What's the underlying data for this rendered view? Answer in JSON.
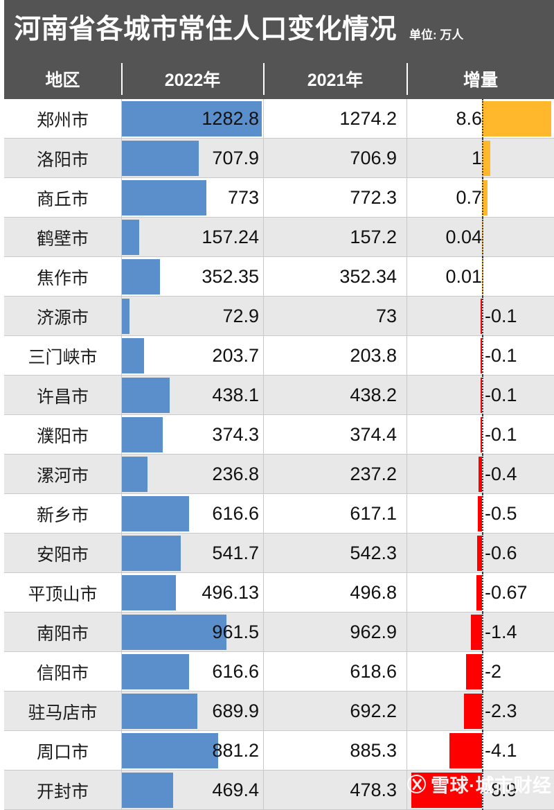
{
  "header": {
    "title": "河南省各城市常住人口变化情况",
    "unit_label": "单位: 万人",
    "columns": [
      "地区",
      "2022年",
      "2021年",
      "增量"
    ]
  },
  "watermark": {
    "text": "雪球·城市财经",
    "logo_icon": "xueqiu-x-logo-icon"
  },
  "colors": {
    "header_bg": "#545454",
    "bar_positive": "#5b8fcb",
    "delta_positive": "#ffb72b",
    "delta_negative": "#fe0000",
    "row_even_bg": "#e8e8e8",
    "row_odd_bg": "#ffffff",
    "grid_line": "#c9c9c9"
  },
  "chart_data": {
    "type": "bar",
    "title": "河南省各城市常住人口变化情况",
    "subtitle": "单位: 万人",
    "xlabel": "",
    "ylabel": "",
    "categories": [
      "郑州市",
      "洛阳市",
      "商丘市",
      "鹤壁市",
      "焦作市",
      "济源市",
      "三门峡市",
      "许昌市",
      "濮阳市",
      "漯河市",
      "新乡市",
      "安阳市",
      "平顶山市",
      "南阳市",
      "信阳市",
      "驻马店市",
      "周口市",
      "开封市"
    ],
    "series": [
      {
        "name": "2022年",
        "values": [
          1282.8,
          707.9,
          773,
          157.24,
          352.35,
          72.9,
          203.7,
          438.1,
          374.3,
          236.8,
          616.6,
          541.7,
          496.13,
          961.5,
          616.6,
          689.9,
          881.2,
          469.4
        ],
        "labels": [
          "1282.8",
          "707.9",
          "773",
          "157.24",
          "352.35",
          "72.9",
          "203.7",
          "438.1",
          "374.3",
          "236.8",
          "616.6",
          "541.7",
          "496.13",
          "961.5",
          "616.6",
          "689.9",
          "881.2",
          "469.4"
        ],
        "bar": true,
        "color": "#5b8fcb",
        "max": 1282.8
      },
      {
        "name": "2021年",
        "values": [
          1274.2,
          706.9,
          772.3,
          157.2,
          352.34,
          73,
          203.8,
          438.2,
          374.4,
          237.2,
          617.1,
          542.3,
          496.8,
          962.9,
          618.6,
          692.2,
          885.3,
          478.3
        ],
        "labels": [
          "1274.2",
          "706.9",
          "772.3",
          "157.2",
          "352.34",
          "73",
          "203.8",
          "438.2",
          "374.4",
          "237.2",
          "617.1",
          "542.3",
          "496.8",
          "962.9",
          "618.6",
          "692.2",
          "885.3",
          "478.3"
        ],
        "bar": false
      },
      {
        "name": "增量",
        "values": [
          8.6,
          1,
          0.7,
          0.04,
          0.01,
          -0.1,
          -0.1,
          -0.1,
          -0.1,
          -0.4,
          -0.5,
          -0.6,
          -0.67,
          -1.4,
          -2,
          -2.3,
          -4.1,
          -8.9
        ],
        "labels": [
          "8.6",
          "1",
          "0.7",
          "0.04",
          "0.01",
          "-0.1",
          "-0.1",
          "-0.1",
          "-0.1",
          "-0.4",
          "-0.5",
          "-0.6",
          "-0.67",
          "-1.4",
          "-2",
          "-2.3",
          "-4.1",
          "-8.9"
        ],
        "bar": true,
        "diverging": true,
        "color_positive": "#ffb72b",
        "color_negative": "#fe0000",
        "max_abs": 9.0
      }
    ],
    "grid": false,
    "legend": "none",
    "zero_axis": true
  },
  "rows": [
    {
      "region": "郑州市",
      "y2022": "1282.8",
      "y2021": "1274.2",
      "delta": "8.6",
      "v2022": 1282.8,
      "vdelta": 8.6
    },
    {
      "region": "洛阳市",
      "y2022": "707.9",
      "y2021": "706.9",
      "delta": "1",
      "v2022": 707.9,
      "vdelta": 1
    },
    {
      "region": "商丘市",
      "y2022": "773",
      "y2021": "772.3",
      "delta": "0.7",
      "v2022": 773,
      "vdelta": 0.7
    },
    {
      "region": "鹤壁市",
      "y2022": "157.24",
      "y2021": "157.2",
      "delta": "0.04",
      "v2022": 157.24,
      "vdelta": 0.04
    },
    {
      "region": "焦作市",
      "y2022": "352.35",
      "y2021": "352.34",
      "delta": "0.01",
      "v2022": 352.35,
      "vdelta": 0.01
    },
    {
      "region": "济源市",
      "y2022": "72.9",
      "y2021": "73",
      "delta": "-0.1",
      "v2022": 72.9,
      "vdelta": -0.1
    },
    {
      "region": "三门峡市",
      "y2022": "203.7",
      "y2021": "203.8",
      "delta": "-0.1",
      "v2022": 203.7,
      "vdelta": -0.1
    },
    {
      "region": "许昌市",
      "y2022": "438.1",
      "y2021": "438.2",
      "delta": "-0.1",
      "v2022": 438.1,
      "vdelta": -0.1
    },
    {
      "region": "濮阳市",
      "y2022": "374.3",
      "y2021": "374.4",
      "delta": "-0.1",
      "v2022": 374.3,
      "vdelta": -0.1
    },
    {
      "region": "漯河市",
      "y2022": "236.8",
      "y2021": "237.2",
      "delta": "-0.4",
      "v2022": 236.8,
      "vdelta": -0.4
    },
    {
      "region": "新乡市",
      "y2022": "616.6",
      "y2021": "617.1",
      "delta": "-0.5",
      "v2022": 616.6,
      "vdelta": -0.5
    },
    {
      "region": "安阳市",
      "y2022": "541.7",
      "y2021": "542.3",
      "delta": "-0.6",
      "v2022": 541.7,
      "vdelta": -0.6
    },
    {
      "region": "平顶山市",
      "y2022": "496.13",
      "y2021": "496.8",
      "delta": "-0.67",
      "v2022": 496.13,
      "vdelta": -0.67
    },
    {
      "region": "南阳市",
      "y2022": "961.5",
      "y2021": "962.9",
      "delta": "-1.4",
      "v2022": 961.5,
      "vdelta": -1.4
    },
    {
      "region": "信阳市",
      "y2022": "616.6",
      "y2021": "618.6",
      "delta": "-2",
      "v2022": 616.6,
      "vdelta": -2
    },
    {
      "region": "驻马店市",
      "y2022": "689.9",
      "y2021": "692.2",
      "delta": "-2.3",
      "v2022": 689.9,
      "vdelta": -2.3
    },
    {
      "region": "周口市",
      "y2022": "881.2",
      "y2021": "885.3",
      "delta": "-4.1",
      "v2022": 881.2,
      "vdelta": -4.1
    },
    {
      "region": "开封市",
      "y2022": "469.4",
      "y2021": "478.3",
      "delta": "-8.9",
      "v2022": 469.4,
      "vdelta": -8.9
    }
  ]
}
